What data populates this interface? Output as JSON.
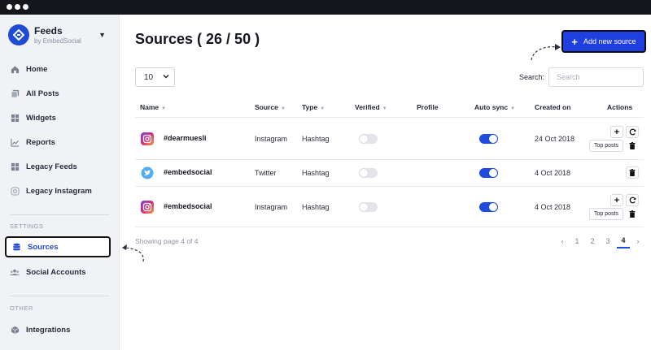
{
  "window": {
    "dots": 3
  },
  "brand": {
    "title": "Feeds",
    "subtitle": "by EmbedSocial",
    "logo_icon": "embedsocial-logo-icon",
    "caret_icon": "caret-down-icon",
    "color": "#1f4bd8"
  },
  "sidebar": {
    "items": [
      {
        "label": "Home",
        "icon": "home-icon"
      },
      {
        "label": "All Posts",
        "icon": "posts-icon"
      },
      {
        "label": "Widgets",
        "icon": "grid-icon"
      },
      {
        "label": "Reports",
        "icon": "chart-icon"
      },
      {
        "label": "Legacy Feeds",
        "icon": "grid-icon"
      },
      {
        "label": "Legacy Instagram",
        "icon": "instagram-outline-icon"
      }
    ],
    "settings_label": "SETTINGS",
    "settings_items": [
      {
        "label": "Sources",
        "icon": "database-icon",
        "active": true
      },
      {
        "label": "Social Accounts",
        "icon": "users-icon"
      }
    ],
    "other_label": "OTHER",
    "other_items": [
      {
        "label": "Integrations",
        "icon": "cube-icon"
      }
    ]
  },
  "main": {
    "title": "Sources ( 26 / 50 )",
    "add_button": "Add new source",
    "page_size": "10",
    "search_label": "Search:",
    "search_placeholder": "Search",
    "columns": [
      "Name",
      "Source",
      "Type",
      "Verified",
      "Profile",
      "Auto sync",
      "Created on",
      "Actions"
    ],
    "rows": [
      {
        "name": "#dearmuesli",
        "source": "Instagram",
        "type": "Hashtag",
        "verified": false,
        "auto_sync": true,
        "created": "24 Oct 2018",
        "has_top_posts": true
      },
      {
        "name": "#embedsocial",
        "source": "Twitter",
        "type": "Hashtag",
        "verified": false,
        "auto_sync": true,
        "created": "4 Oct 2018",
        "has_top_posts": false
      },
      {
        "name": "#embedsocial",
        "source": "Instagram",
        "type": "Hashtag",
        "verified": false,
        "auto_sync": true,
        "created": "4 Oct 2018",
        "has_top_posts": true
      }
    ],
    "top_posts_label": "Top posts",
    "showing": "Showing page 4 of 4",
    "pagination": {
      "prev": "‹",
      "pages": [
        "1",
        "2",
        "3",
        "4"
      ],
      "current": "4",
      "next": "›"
    }
  },
  "colors": {
    "accent": "#1f4be0",
    "sidebar_bg": "#f1f2f6",
    "topbar": "#16161d"
  }
}
